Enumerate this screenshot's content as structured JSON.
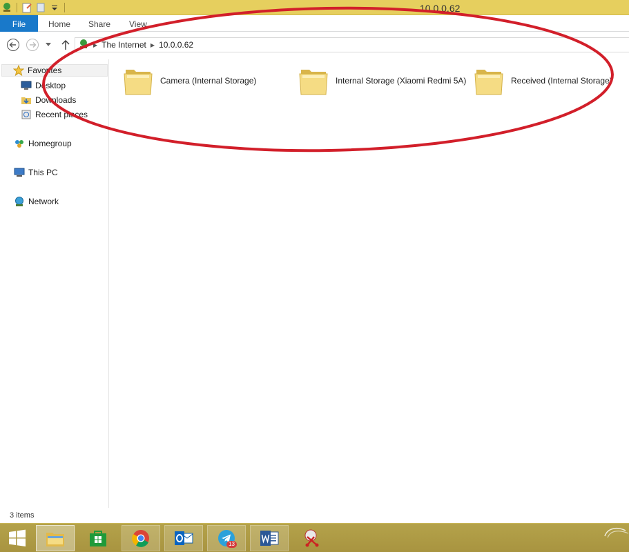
{
  "window": {
    "title": "10.0.0.62"
  },
  "ribbon": {
    "tabs": [
      {
        "label": "File"
      },
      {
        "label": "Home"
      },
      {
        "label": "Share"
      },
      {
        "label": "View"
      }
    ]
  },
  "address": {
    "crumbs": [
      "The Internet",
      "10.0.0.62"
    ]
  },
  "nav": {
    "favorites": "Favorites",
    "desktop": "Desktop",
    "downloads": "Downloads",
    "recent": "Recent places",
    "homegroup": "Homegroup",
    "thispc": "This PC",
    "network": "Network"
  },
  "folders": [
    {
      "name": "Camera (Internal Storage)"
    },
    {
      "name": "Internal Storage (Xiaomi Redmi 5A)"
    },
    {
      "name": "Received (Internal Storage)"
    }
  ],
  "status": {
    "items": "3 items"
  },
  "taskbar": {
    "telegram_badge": "13",
    "apps": [
      "start-icon",
      "file-explorer-icon",
      "store-icon",
      "chrome-icon",
      "outlook-icon",
      "telegram-icon",
      "word-icon",
      "snipping-tool-icon"
    ]
  },
  "colors": {
    "titlebar": "#e6cf5e",
    "file_tab": "#1979ca",
    "annotation": "#d21f2a",
    "taskbar": "#ae9a45"
  }
}
